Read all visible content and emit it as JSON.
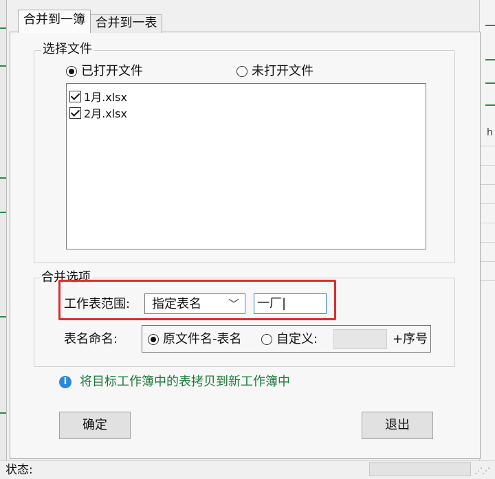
{
  "tabs": [
    {
      "label": "合并到一簿",
      "active": true
    },
    {
      "label": "合并到一表",
      "active": false
    }
  ],
  "select_files": {
    "legend": "选择文件",
    "source_options": [
      {
        "label": "已打开文件",
        "selected": true
      },
      {
        "label": "未打开文件",
        "selected": false
      }
    ],
    "files": [
      {
        "name": "1月.xlsx",
        "checked": true
      },
      {
        "name": "2月.xlsx",
        "checked": true
      }
    ]
  },
  "merge_options": {
    "legend": "合并选项",
    "sheet_range_label": "工作表范围:",
    "sheet_range_value": "指定表名",
    "sheet_name_input": "一厂|",
    "naming_label": "表名命名:",
    "naming_options": [
      {
        "label": "原文件名-表名",
        "selected": true
      },
      {
        "label": "自定义:",
        "selected": false
      }
    ],
    "custom_suffix_value": "",
    "suffix_label": "+序号"
  },
  "info": {
    "text": "将目标工作簿中的表拷贝到新工作簿中"
  },
  "buttons": {
    "ok": "确定",
    "exit": "退出"
  },
  "status": {
    "label": "状态:",
    "value": ""
  },
  "background": {
    "right_header_glyph": "h"
  },
  "colors": {
    "highlight_box": "#e02a2a",
    "info_text": "#1e7a3a",
    "info_icon": "#2b8ad8"
  }
}
